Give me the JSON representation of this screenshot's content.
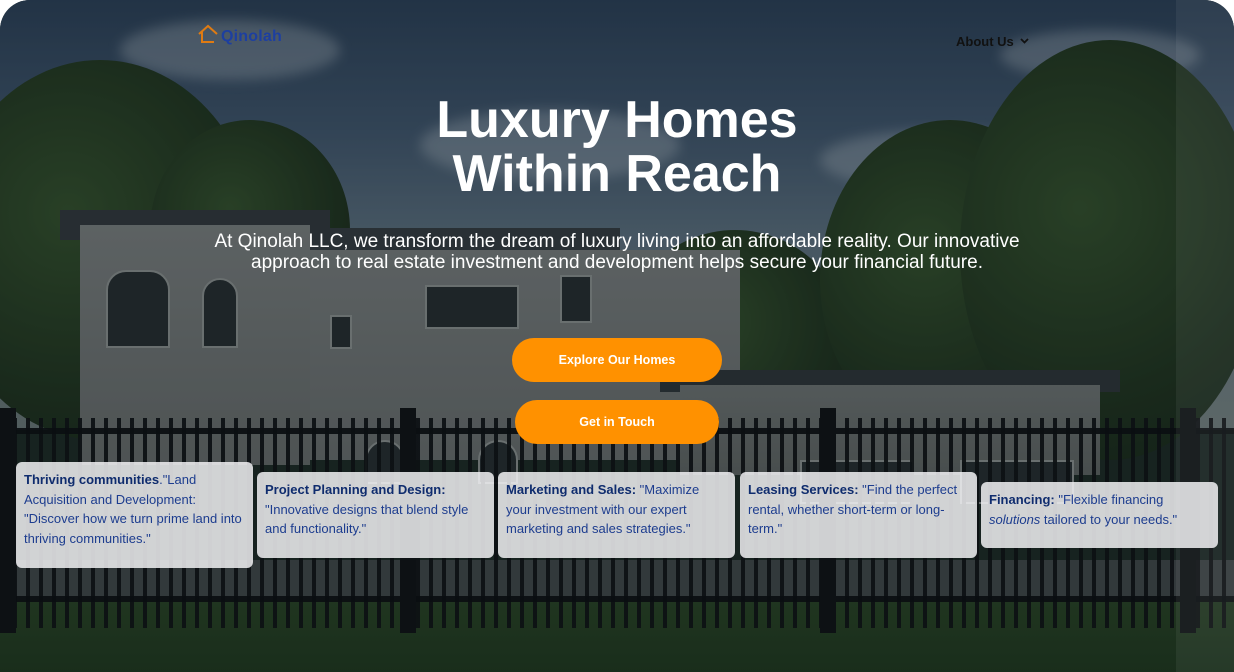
{
  "header": {
    "logo_text": "Qinolah",
    "nav": [
      {
        "label": "About Us",
        "has_dropdown": true
      }
    ]
  },
  "hero": {
    "title_line1": "Luxury Homes",
    "title_line2": "Within Reach",
    "description": "At Qinolah LLC, we transform the dream of luxury living into an affordable reality. Our innovative approach to real estate investment and development helps secure your financial future.",
    "buttons": {
      "explore": "Explore Our Homes",
      "contact": "Get in Touch"
    }
  },
  "services": [
    {
      "heading": "Thriving communities",
      "text": ".\"Land Acquisition and Development: \"Discover how we turn prime land into thriving communities.\""
    },
    {
      "heading": "Project Planning and Design:",
      "text": " \"Innovative designs that blend style and functionality.\""
    },
    {
      "heading": "Marketing and Sales:",
      "text": " \"Maximize your investment with our expert marketing and sales strategies.\""
    },
    {
      "heading": "Leasing Services:",
      "text": " \"Find the perfect rental, whether short-term or long-term.\""
    },
    {
      "heading": "Financing:",
      "text_before": " \"Flexible financing ",
      "text_em": "solutions",
      "text_after": " tailored to your needs.\""
    }
  ],
  "colors": {
    "accent": "#ff9100",
    "brand": "#1d3fa0",
    "card_text": "#1d3d8f"
  },
  "icons": {
    "logo": "house-outline-icon",
    "nav_dropdown": "chevron-down-icon"
  }
}
